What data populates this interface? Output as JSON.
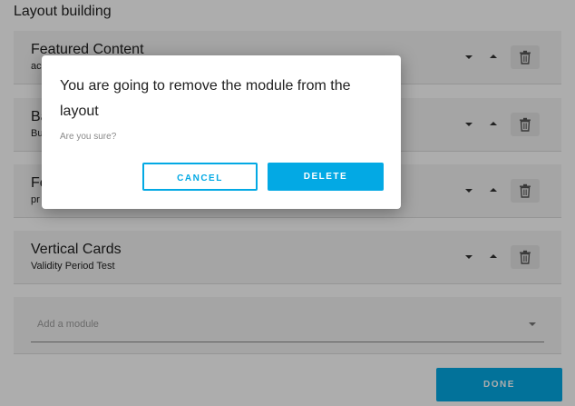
{
  "page": {
    "title": "Layout building"
  },
  "modules": [
    {
      "title": "Featured Content",
      "subtitle": "ac"
    },
    {
      "title": "Ba",
      "subtitle": "Bu"
    },
    {
      "title": "Fe",
      "subtitle": "pr"
    },
    {
      "title": "Vertical Cards",
      "subtitle": "Validity Period Test"
    }
  ],
  "add_module": {
    "placeholder": "Add a module"
  },
  "done_label": "DONE",
  "dialog": {
    "title": "You are going to remove the module from the layout",
    "subtitle": "Are you sure?",
    "cancel_label": "CANCEL",
    "delete_label": "DELETE"
  },
  "icons": {
    "move_down": "caret-down-icon",
    "move_up": "caret-up-icon",
    "remove": "trash-icon",
    "dropdown": "dropdown-arrow-icon"
  },
  "colors": {
    "accent": "#03a9e4",
    "card": "#f3f3f3",
    "scrim": "rgba(0,0,0,0.32)"
  }
}
